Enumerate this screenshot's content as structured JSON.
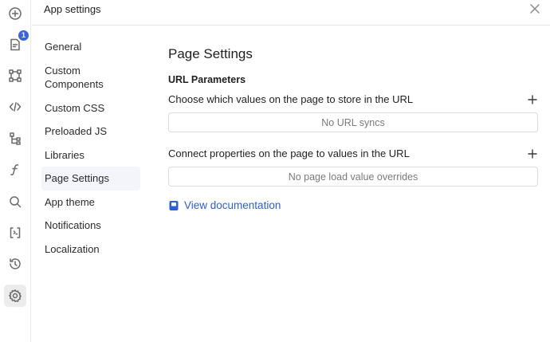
{
  "window": {
    "title": "App settings"
  },
  "rail": {
    "badge_count": "1",
    "icons": [
      "add-icon",
      "pages-icon",
      "components-icon",
      "code-icon",
      "tree-icon",
      "function-icon",
      "search-icon",
      "state-icon",
      "history-icon",
      "gear-icon"
    ]
  },
  "nav": {
    "items": [
      {
        "label": "General"
      },
      {
        "label": "Custom Components"
      },
      {
        "label": "Custom CSS"
      },
      {
        "label": "Preloaded JS"
      },
      {
        "label": "Libraries"
      },
      {
        "label": "Page Settings"
      },
      {
        "label": "App theme"
      },
      {
        "label": "Notifications"
      },
      {
        "label": "Localization"
      }
    ],
    "selected": "Page Settings"
  },
  "main": {
    "title": "Page Settings",
    "section_title": "URL Parameters",
    "store_label": "Choose which values on the page to store in the URL",
    "store_empty": "No URL syncs",
    "connect_label": "Connect properties on the page to values in the URL",
    "connect_empty": "No page load value overrides",
    "docs_link": "View documentation"
  },
  "colors": {
    "accent": "#2d5fd6",
    "badge": "#3a63e0"
  }
}
